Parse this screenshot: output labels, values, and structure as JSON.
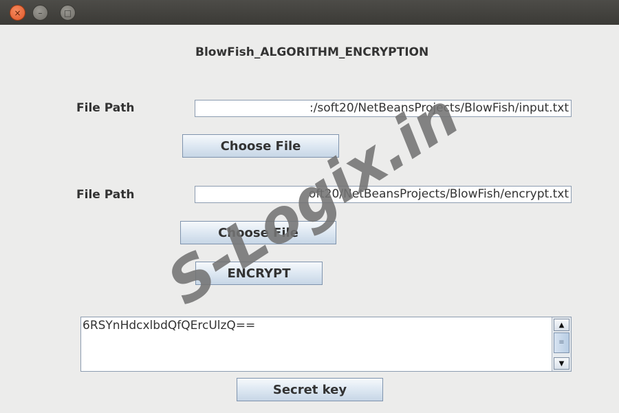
{
  "window": {
    "close_glyph": "×",
    "minimize_glyph": "–",
    "maximize_glyph": "□"
  },
  "heading": "BlowFish_ALGORITHM_ENCRYPTION",
  "input_section": {
    "label": "File Path",
    "value": ":/soft20/NetBeansProjects/BlowFish/input.txt",
    "button": "Choose File"
  },
  "output_section": {
    "label": "File Path",
    "value": "oft20/NetBeansProjects/BlowFish/encrypt.txt",
    "button": "Choose File"
  },
  "encrypt_button": "ENCRYPT",
  "result": {
    "text": "6RSYnHdcxlbdQfQErcUlzQ==",
    "scroll_up": "▲",
    "scroll_down": "▼",
    "thumb_grip": "≡"
  },
  "secret_key_button": "Secret key",
  "watermark": "S-Logix.in",
  "colors": {
    "titlebar": "#3f3e3a",
    "close_button": "#e55b2c",
    "window_bg": "#ececeb"
  }
}
